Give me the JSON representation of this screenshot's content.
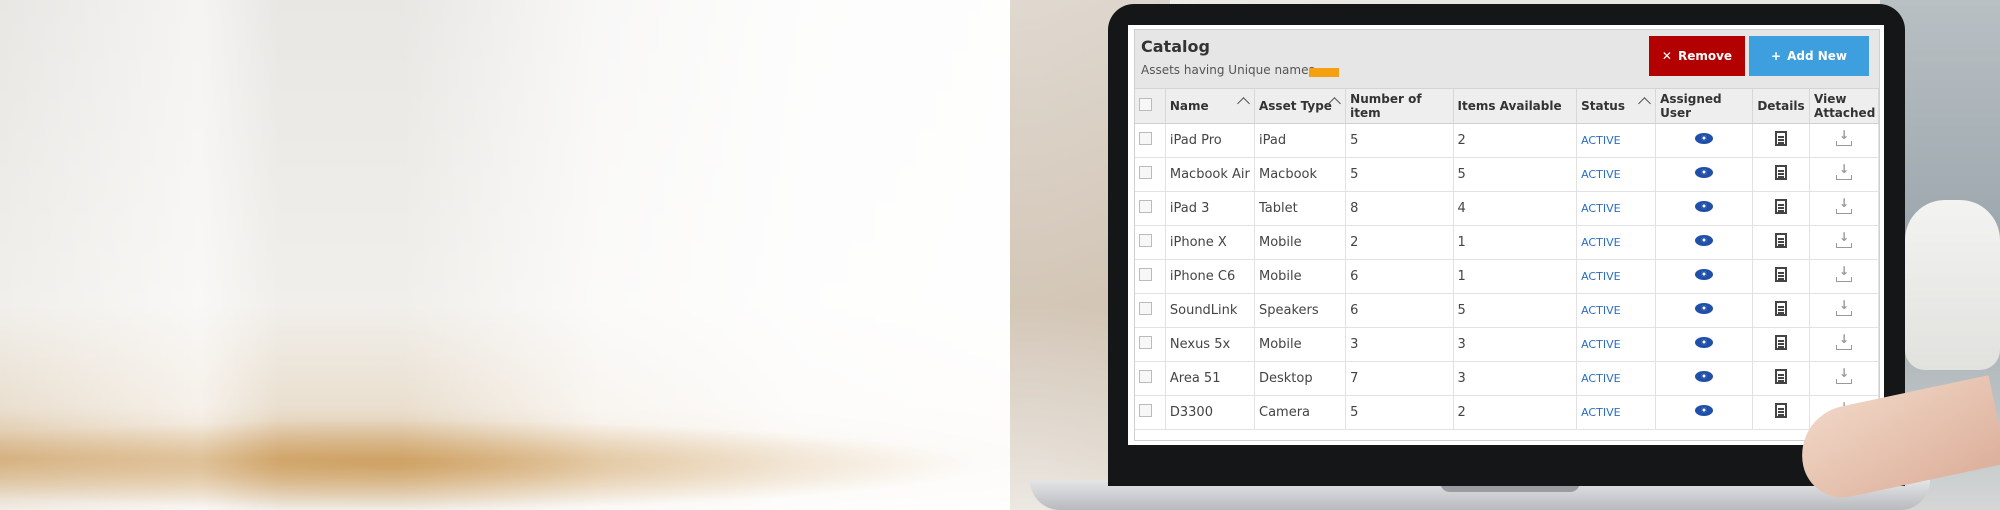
{
  "catalog": {
    "title": "Catalog",
    "subtitle": "Assets having Unique names",
    "remove_label": "Remove",
    "add_label": "Add New"
  },
  "columns": [
    "Name",
    "Asset Type",
    "Number of item",
    "Items Available",
    "Status",
    "Assigned User",
    "Details",
    "View Attached"
  ],
  "rows": [
    {
      "name": "iPad Pro",
      "type": "iPad",
      "count": "5",
      "available": "2",
      "status": "ACTIVE"
    },
    {
      "name": "Macbook Air",
      "type": "Macbook",
      "count": "5",
      "available": "5",
      "status": "ACTIVE"
    },
    {
      "name": "iPad 3",
      "type": "Tablet",
      "count": "8",
      "available": "4",
      "status": "ACTIVE"
    },
    {
      "name": "iPhone X",
      "type": "Mobile",
      "count": "2",
      "available": "1",
      "status": "ACTIVE"
    },
    {
      "name": "iPhone C6",
      "type": "Mobile",
      "count": "6",
      "available": "1",
      "status": "ACTIVE"
    },
    {
      "name": "SoundLink",
      "type": "Speakers",
      "count": "6",
      "available": "5",
      "status": "ACTIVE"
    },
    {
      "name": "Nexus 5x",
      "type": "Mobile",
      "count": "3",
      "available": "3",
      "status": "ACTIVE"
    },
    {
      "name": "Area 51",
      "type": "Desktop",
      "count": "7",
      "available": "3",
      "status": "ACTIVE"
    },
    {
      "name": "D3300",
      "type": "Camera",
      "count": "5",
      "available": "2",
      "status": "ACTIVE"
    }
  ],
  "icons": {
    "remove": "close-icon",
    "add": "plus-icon",
    "assigned_user": "eye-icon",
    "details": "document-icon",
    "view_attached": "download-icon"
  },
  "colors": {
    "remove": "#b30000",
    "add": "#3e9fde",
    "status": "#2a6dc2",
    "subtitle_bar": "#f5a011"
  }
}
